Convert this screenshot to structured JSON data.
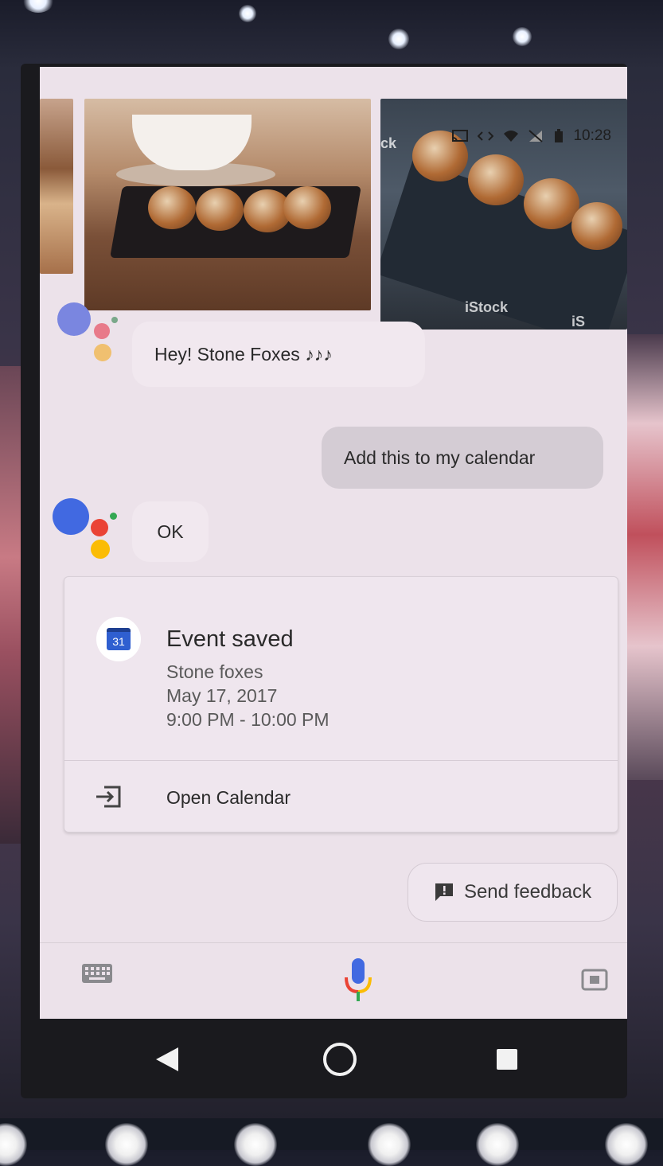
{
  "status_bar": {
    "time": "10:28"
  },
  "photos": {
    "watermark_left": "ck",
    "watermark_main": "iStock",
    "watermark_right": "iS"
  },
  "conversation": {
    "assistant_greeting": "Hey! Stone Foxes ♪♪♪",
    "user_message": "Add this to my calendar",
    "assistant_reply": "OK"
  },
  "event_card": {
    "calendar_icon_day": "31",
    "title": "Event saved",
    "event_name": "Stone foxes",
    "date": "May 17, 2017",
    "time": "9:00 PM - 10:00 PM",
    "action_label": "Open Calendar"
  },
  "feedback": {
    "label": "Send feedback"
  },
  "input_bar": {
    "icons": [
      "keyboard-icon",
      "microphone-icon",
      "lens-icon"
    ]
  },
  "nav": {
    "icons": [
      "back-icon",
      "home-icon",
      "recents-icon"
    ]
  },
  "colors": {
    "assistant_blue": "#4169e1",
    "assistant_red": "#ea4335",
    "assistant_yellow": "#fbbc05",
    "assistant_green": "#34a853",
    "calendar_blue": "#2f5fd0"
  }
}
